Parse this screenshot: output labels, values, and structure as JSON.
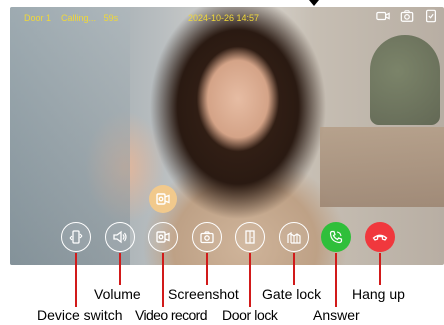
{
  "status": {
    "door": "Door 1",
    "state": "Calling...",
    "duration": "59s",
    "datetime": "2024-10-26  14:57"
  },
  "top_icons": [
    "video-icon",
    "camera-icon",
    "memo-icon"
  ],
  "controls": [
    {
      "id": "device-switch",
      "icon": "device-switch-icon"
    },
    {
      "id": "volume",
      "icon": "speaker-icon"
    },
    {
      "id": "video-record",
      "icon": "video-record-icon"
    },
    {
      "id": "screenshot",
      "icon": "camera-icon"
    },
    {
      "id": "door-lock",
      "icon": "door-icon"
    },
    {
      "id": "gate-lock",
      "icon": "gate-icon"
    },
    {
      "id": "answer",
      "icon": "phone-icon",
      "color": "#2fbf3a"
    },
    {
      "id": "hang-up",
      "icon": "hang-up-icon",
      "color": "#f0383d"
    }
  ],
  "callouts": {
    "device_switch": "Device switch",
    "volume": "Volume",
    "video_record": "Video record",
    "screenshot": "Screenshot",
    "door_lock": "Door lock",
    "gate_lock": "Gate lock",
    "answer": "Answer",
    "hang_up": "Hang up"
  },
  "colors": {
    "status_text": "#f0d838",
    "leader_line": "#d11a1a",
    "floating_button": "#f1c98c"
  }
}
